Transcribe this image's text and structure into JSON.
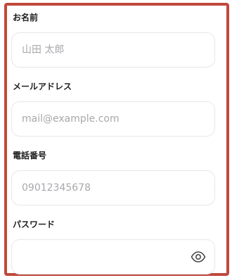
{
  "form": {
    "name": {
      "label": "お名前",
      "placeholder": "山田 太郎",
      "value": ""
    },
    "email": {
      "label": "メールアドレス",
      "placeholder": "mail@example.com",
      "value": ""
    },
    "phone": {
      "label": "電話番号",
      "placeholder": "09012345678",
      "value": ""
    },
    "password": {
      "label": "パスワード",
      "placeholder": "",
      "value": "",
      "toggle_icon": "eye-icon"
    }
  },
  "colors": {
    "frame_border": "#c0483b",
    "input_border": "#e7e7e9",
    "placeholder": "#a8a8ac",
    "label": "#1f1f1f"
  }
}
